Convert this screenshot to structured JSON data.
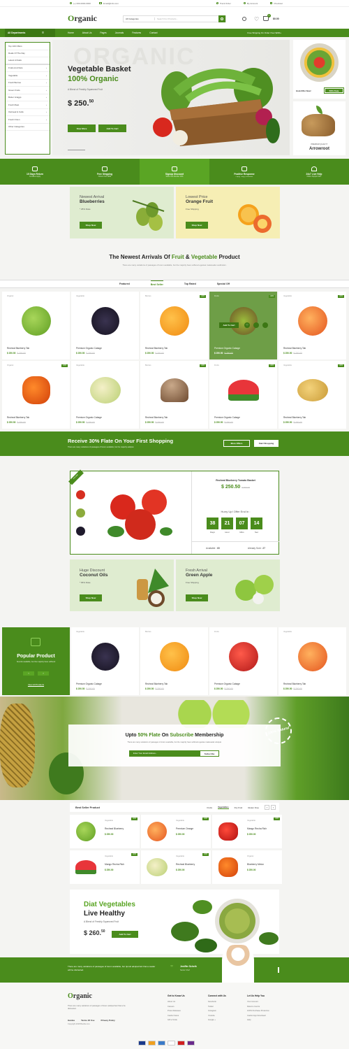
{
  "topbar": {
    "phone": "(+) 000-0000-0000",
    "email": "Email@info.com",
    "track": "Track Order",
    "account": "My Account",
    "checkout": "Checkout"
  },
  "header": {
    "logo_o": "O",
    "logo_rest": "rganic",
    "category_select": "All Categories",
    "search_placeholder": "Search For Products...",
    "cart_total": "$0.00",
    "cart_count": "0"
  },
  "nav": {
    "departments": "All Departments",
    "items": [
      "Home",
      "About Us",
      "Pages",
      "Journals",
      "Features",
      "Contact"
    ],
    "shipping_note": "Free Shipping On Order Over $200+"
  },
  "sidebar": {
    "items": [
      "Top 100 Offers",
      "Deals Of The Day",
      "Latest Arrivals",
      "Fruits And Nuts",
      "Vegetable",
      "Fresh Berries",
      "Green Fruits",
      "Butter & Eggs",
      "Fresh Meat",
      "Oatmeal & Cello",
      "Fresh Onion",
      "Other Categories"
    ]
  },
  "hero": {
    "title1": "Vegetable Basket",
    "title2": "100% Organic",
    "subtitle": "A Blend of Freshly Squeezed Fruit",
    "price": "$ 250.",
    "price_cents": "50",
    "btn_more": "View More",
    "btn_cart": "Add To Cart",
    "watermark": "ORGANIC"
  },
  "side_banners": {
    "top_label": "Grab Offer Now!",
    "top_btn": "50% Flate",
    "bottom_small": "PREMIUM QUALITY",
    "bottom_title": "Arrowroot"
  },
  "features": [
    {
      "title": "15 Days Return",
      "sub": "Condition Apply"
    },
    {
      "title": "Free Shipping",
      "sub": "Orders Over $200"
    },
    {
      "title": "Signup Discount",
      "sub": "Save Free Member 10%"
    },
    {
      "title": "Positive Response",
      "sub": "Happy Happy Feedback"
    },
    {
      "title": "24x7 Live Help",
      "sub": "Online Support 24x7"
    }
  ],
  "promos": [
    {
      "small": "Newest Arrival",
      "title": "Blueberries",
      "note": "* 25% Flate",
      "btn": "Shop Now"
    },
    {
      "small": "Lowest Price",
      "title": "Orange Fruit",
      "note": "Free Shipping",
      "btn": "Shop Now"
    }
  ],
  "arrivals": {
    "t1": "The Newest Arrivals Of ",
    "t2": "Fruit",
    "t3": " & ",
    "t4": "Vegetable",
    "t5": " Product",
    "sub": "There are many variations of passages of lorem available, but the majority have suffered egestas malesuada vestibulum."
  },
  "tabs": [
    "Featured",
    "Best Seller",
    "Top Rated",
    "Special Off"
  ],
  "products": [
    {
      "cat": "Organic",
      "name": "Recheal Blueberry Tab",
      "price": "$ 250.50",
      "old": "$ 300.00",
      "badge": ""
    },
    {
      "cat": "Vegetable",
      "name": "Premium Organic Cabage",
      "price": "$ 250.50",
      "old": "$ 300.00",
      "badge": ""
    },
    {
      "cat": "Berries",
      "name": "Recheal Blueberry Tab",
      "price": "$ 250.50",
      "old": "$ 300.00",
      "badge": "-10%"
    },
    {
      "cat": "Fruits",
      "name": "Premium Organic Cabage",
      "price": "$ 250.50",
      "old": "$ 300.00",
      "badge": "-10%"
    },
    {
      "cat": "Vegetable",
      "name": "Recheal Blueberry Tab",
      "price": "$ 250.50",
      "old": "$ 300.00",
      "badge": "-10%"
    },
    {
      "cat": "Organic",
      "name": "Recheal Blueberry Tab",
      "price": "$ 250.50",
      "old": "$ 300.00",
      "badge": "-10%"
    },
    {
      "cat": "Vegetable",
      "name": "Premium Organic Cabage",
      "price": "$ 250.50",
      "old": "$ 300.00",
      "badge": ""
    },
    {
      "cat": "Berries",
      "name": "Recheal Blueberry Tab",
      "price": "$ 250.50",
      "old": "$ 300.00",
      "badge": "-10%"
    },
    {
      "cat": "Fruits",
      "name": "Premium Organic Cabage",
      "price": "$ 250.50",
      "old": "$ 300.00",
      "badge": "-10%"
    },
    {
      "cat": "Vegetable",
      "name": "Recheal Blueberry Tab",
      "price": "$ 250.50",
      "old": "$ 300.00",
      "badge": "-10%"
    }
  ],
  "hover_btn": "Add To Cart",
  "band": {
    "t1": "Receive ",
    "t2": "30% Flate",
    "t3": " On Your First Shopping",
    "sub": "There are many variations of passages of lorem available, but the majority adolpat.",
    "btn1": "More Offers",
    "btn2": "Start Shopping"
  },
  "deal": {
    "ribbon": "Hot Deal",
    "name": "Recheal Blueberry Tomato Basket",
    "price": "$ 250.50",
    "old": "$ 300.00",
    "hurry": "Hurry Up! Offer End In :",
    "days": "38",
    "hours": "21",
    "mins": "07",
    "secs": "14",
    "l_days": "Days",
    "l_hour": "Hour",
    "l_mins": "Mins",
    "l_sec": "Sec",
    "available_l": "Available :",
    "available": "60",
    "sold_l": "Already Sold :",
    "sold": "27"
  },
  "promos2": [
    {
      "small": "Huge Discount",
      "title": "Coconut Oils",
      "note": "* 65% Flate",
      "btn": "Shop Now"
    },
    {
      "small": "Fresh Arrival",
      "title": "Green Apple",
      "note": "Free Shipping",
      "btn": "Shop Now"
    }
  ],
  "popular": {
    "title": "Popular Product",
    "sub": "Sounds available, but the majority have suffered",
    "link": "View All Products"
  },
  "popular_products": [
    {
      "cat": "Vegetable",
      "name": "Premium Organic Cabage",
      "price": "$ 250.50",
      "old": "$ 300.00"
    },
    {
      "cat": "Berries",
      "name": "Recheal Blueberry Tab",
      "price": "$ 250.50",
      "old": "$ 300.00"
    },
    {
      "cat": "Fruits",
      "name": "Premium Organic Cabage",
      "price": "$ 250.50",
      "old": "$ 300.00"
    },
    {
      "cat": "Vegetable",
      "name": "Recheal Blueberry Tab",
      "price": "$ 250.50",
      "old": "$ 300.00"
    }
  ],
  "subscribe": {
    "t1": "Upto ",
    "t2": "50% Flate",
    "t3": " On ",
    "t4": "Subscribe",
    "t5": " Membership",
    "sub": "There are many variations of passages of lorem available, but the majority have suffered egestas malesuada volutpat.",
    "placeholder": "Enter Your Email Address...",
    "btn": "Subscribe",
    "seal": "100% Natural"
  },
  "bestseller": {
    "title": "Best Seller Product",
    "tabs": [
      "Fruits",
      "Vegetables",
      "Dry Fruit",
      "Gluten Free"
    ]
  },
  "bs_items": [
    {
      "cat": "Vegetable",
      "name": "Recheal Blueberry",
      "price": "$ 250.00"
    },
    {
      "cat": "Vegetable",
      "name": "Premium Orange",
      "price": "$ 250.00"
    },
    {
      "cat": "Vegetable",
      "name": "Mango Recha Rich",
      "price": "$ 250.00"
    },
    {
      "cat": "Vegetable",
      "name": "Mango Recha Rich",
      "price": "$ 250.00"
    },
    {
      "cat": "Vegetable",
      "name": "Recheal Blueberry",
      "price": "$ 250.00"
    },
    {
      "cat": "Organic",
      "name": "Blueberry Melon",
      "price": "$ 250.00"
    }
  ],
  "diet": {
    "t1": "Diat Vegetables",
    "t2": "Live Healthy",
    "sub": "A Blend of Freshly Squeezed Fruit",
    "price": "$ 260.",
    "cents": "50",
    "btn": "Add To Cart"
  },
  "testimonial": {
    "text": "There are many variations of passages of lorem available, but ripcutt adolpat fact that a reader will be distracted.",
    "name": "Jeniffer Scheth",
    "role": "Senior Chef"
  },
  "footer": {
    "desc": "There are many variations of passages of lorem adolpat fact that a be distracted.",
    "links": [
      "Guides",
      "Terms Of Use",
      "Privacy Policy"
    ],
    "copyright": "Copyright 2018 Bootfa.com.",
    "cols": [
      {
        "h": "Get to Know Us",
        "items": [
          "About Us",
          "Careers",
          "Press Releases",
          "Cashel Cares",
          "Gift a Smile"
        ]
      },
      {
        "h": "Connect with Us",
        "items": [
          "Facebook",
          "Twitter",
          "Instagram",
          "Youtube",
          "Google +"
        ]
      },
      {
        "h": "Let Us Help You",
        "items": [
          "Your Account",
          "Returns Centre",
          "100% Purchase Protection",
          "Cashel App Download",
          "Help"
        ]
      }
    ],
    "payments": [
      "VISA",
      "MC",
      "AMEX",
      "PayPal",
      "Maestro",
      "Skrill"
    ]
  },
  "colors": {
    "brand": "#4a8c1c",
    "light_green": "#dfeccf",
    "yellow_banner": "#f6eeb4"
  }
}
